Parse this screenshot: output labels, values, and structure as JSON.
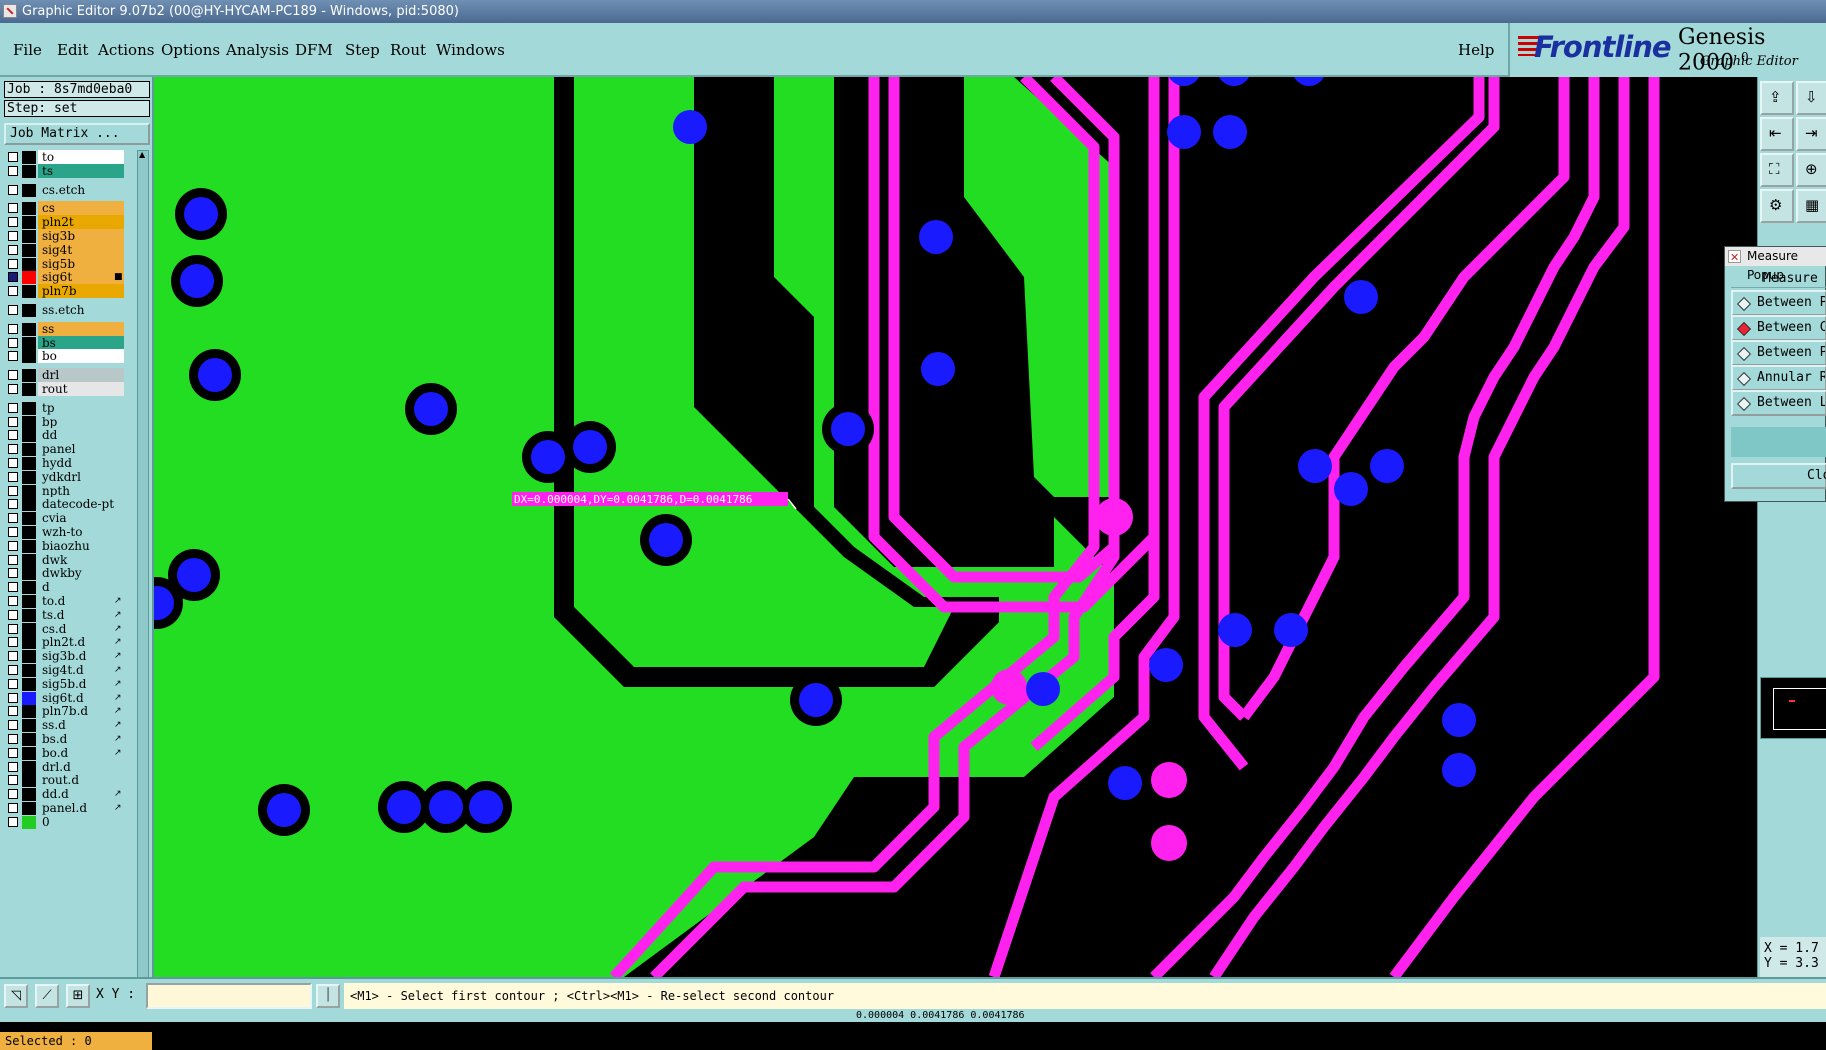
{
  "window": {
    "title": "Graphic Editor 9.07b2 (00@HY-HYCAM-PC189 - Windows, pid:5080)"
  },
  "menu": {
    "items": [
      "File",
      "Edit",
      "Actions",
      "Options",
      "Analysis",
      "DFM",
      "Step",
      "Rout",
      "Windows"
    ],
    "help": "Help"
  },
  "brand": {
    "logo": "Frontline",
    "product": "Genesis 2000",
    "version_mark": "0",
    "subtitle": "Graphic Editor"
  },
  "job": {
    "job_line": "Job : 8s7md0eba0",
    "step_line": "Step: set",
    "matrix_button": "Job Matrix ..."
  },
  "layers": [
    {
      "name": "to",
      "bg": "#ffffff",
      "sw": "#000000",
      "gap": false
    },
    {
      "name": "ts",
      "bg": "#2aa58a",
      "sw": "#000000",
      "gap": false
    },
    {
      "name": "cs.etch",
      "bg": "#a3d9d9",
      "sw": "#000000",
      "gap": true
    },
    {
      "name": "cs",
      "bg": "#f0b040",
      "sw": "#000000",
      "gap": true
    },
    {
      "name": "pln2t",
      "bg": "#e8a800",
      "sw": "#000000",
      "gap": false
    },
    {
      "name": "sig3b",
      "bg": "#f0b040",
      "sw": "#000000",
      "gap": false
    },
    {
      "name": "sig4t",
      "bg": "#f0b040",
      "sw": "#000000",
      "gap": false
    },
    {
      "name": "sig5b",
      "bg": "#f0b040",
      "sw": "#000000",
      "gap": false
    },
    {
      "name": "sig6t",
      "bg": "#f0b040",
      "sw": "#ff0000",
      "gap": false,
      "mark": "■",
      "checked": true
    },
    {
      "name": "pln7b",
      "bg": "#e8a800",
      "sw": "#000000",
      "gap": false
    },
    {
      "name": "ss.etch",
      "bg": "#a3d9d9",
      "sw": "#000000",
      "gap": true
    },
    {
      "name": "ss",
      "bg": "#f0b040",
      "sw": "#000000",
      "gap": true
    },
    {
      "name": "bs",
      "bg": "#2aa58a",
      "sw": "#000000",
      "gap": false
    },
    {
      "name": "bo",
      "bg": "#ffffff",
      "sw": "#000000",
      "gap": false
    },
    {
      "name": "drl",
      "bg": "#b8c8c8",
      "sw": "#000000",
      "gap": true
    },
    {
      "name": "rout",
      "bg": "#e6e6e6",
      "sw": "#000000",
      "gap": false
    },
    {
      "name": "tp",
      "bg": "#a3d9d9",
      "sw": "#000000",
      "gap": true
    },
    {
      "name": "bp",
      "bg": "#a3d9d9",
      "sw": "#000000",
      "gap": false
    },
    {
      "name": "dd",
      "bg": "#a3d9d9",
      "sw": "#000000",
      "gap": false
    },
    {
      "name": "panel",
      "bg": "#a3d9d9",
      "sw": "#000000",
      "gap": false
    },
    {
      "name": "hydd",
      "bg": "#a3d9d9",
      "sw": "#000000",
      "gap": false
    },
    {
      "name": "ydkdrl",
      "bg": "#a3d9d9",
      "sw": "#000000",
      "gap": false
    },
    {
      "name": "npth",
      "bg": "#a3d9d9",
      "sw": "#000000",
      "gap": false
    },
    {
      "name": "datecode-pt",
      "bg": "#a3d9d9",
      "sw": "#000000",
      "gap": false
    },
    {
      "name": "cvia",
      "bg": "#a3d9d9",
      "sw": "#000000",
      "gap": false
    },
    {
      "name": "wzh-to",
      "bg": "#a3d9d9",
      "sw": "#000000",
      "gap": false
    },
    {
      "name": "biaozhu",
      "bg": "#a3d9d9",
      "sw": "#000000",
      "gap": false
    },
    {
      "name": "dwk",
      "bg": "#a3d9d9",
      "sw": "#000000",
      "gap": false
    },
    {
      "name": "dwkby",
      "bg": "#a3d9d9",
      "sw": "#000000",
      "gap": false
    },
    {
      "name": "d",
      "bg": "#a3d9d9",
      "sw": "#000000",
      "gap": false
    },
    {
      "name": "to.d",
      "bg": "#a3d9d9",
      "sw": "#000000",
      "gap": false,
      "mark": "↗"
    },
    {
      "name": "ts.d",
      "bg": "#a3d9d9",
      "sw": "#000000",
      "gap": false,
      "mark": "↗"
    },
    {
      "name": "cs.d",
      "bg": "#a3d9d9",
      "sw": "#000000",
      "gap": false,
      "mark": "↗"
    },
    {
      "name": "pln2t.d",
      "bg": "#a3d9d9",
      "sw": "#000000",
      "gap": false,
      "mark": "↗"
    },
    {
      "name": "sig3b.d",
      "bg": "#a3d9d9",
      "sw": "#000000",
      "gap": false,
      "mark": "↗"
    },
    {
      "name": "sig4t.d",
      "bg": "#a3d9d9",
      "sw": "#000000",
      "gap": false,
      "mark": "↗"
    },
    {
      "name": "sig5b.d",
      "bg": "#a3d9d9",
      "sw": "#000000",
      "gap": false,
      "mark": "↗"
    },
    {
      "name": "sig6t.d",
      "bg": "#a3d9d9",
      "sw": "#1a1aff",
      "gap": false,
      "mark": "↗"
    },
    {
      "name": "pln7b.d",
      "bg": "#a3d9d9",
      "sw": "#000000",
      "gap": false,
      "mark": "↗"
    },
    {
      "name": "ss.d",
      "bg": "#a3d9d9",
      "sw": "#000000",
      "gap": false,
      "mark": "↗"
    },
    {
      "name": "bs.d",
      "bg": "#a3d9d9",
      "sw": "#000000",
      "gap": false,
      "mark": "↗"
    },
    {
      "name": "bo.d",
      "bg": "#a3d9d9",
      "sw": "#000000",
      "gap": false,
      "mark": "↗"
    },
    {
      "name": "drl.d",
      "bg": "#a3d9d9",
      "sw": "#000000",
      "gap": false
    },
    {
      "name": "rout.d",
      "bg": "#a3d9d9",
      "sw": "#000000",
      "gap": false
    },
    {
      "name": "dd.d",
      "bg": "#a3d9d9",
      "sw": "#000000",
      "gap": false,
      "mark": "↗"
    },
    {
      "name": "panel.d",
      "bg": "#a3d9d9",
      "sw": "#000000",
      "gap": false,
      "mark": "↗"
    },
    {
      "name": "0",
      "bg": "#a3d9d9",
      "sw": "#22cc22",
      "gap": false
    }
  ],
  "selected": "Selected : 0",
  "measure_label": "DX=0.000004,DY=0.0041786,D=0.0041786",
  "measure_popup": {
    "title": "Measure Popup",
    "header": "Measure",
    "options": [
      {
        "label": "Between Pads",
        "selected": false
      },
      {
        "label": "Between Contours",
        "selected": true
      },
      {
        "label": "Between Points",
        "selected": false
      },
      {
        "label": "Annular Ring",
        "selected": false
      },
      {
        "label": "Between Layers",
        "selected": false
      }
    ],
    "close": "Close"
  },
  "coords": {
    "x": "X = 1.7",
    "y": "Y = 3.3"
  },
  "status": {
    "xy_label": "X Y :",
    "xy_value": "",
    "prompt": "<M1> - Select first contour ; <Ctrl><M1> - Re-select second contour",
    "bottom_readout": "0.000004    0.0041786    0.0041786"
  },
  "colors": {
    "board": "#22dd22",
    "background": "#000000",
    "trace": "#ff22ee",
    "pad": "#1a1aff",
    "panel": "#a3d9d9"
  },
  "icons": {
    "tools": [
      "zoom-home-icon",
      "fit-icon",
      "pan-left-icon",
      "pan-right-icon",
      "zoom-fit-icon",
      "zoom-area-icon",
      "settings-icon",
      "grid-icon"
    ]
  }
}
